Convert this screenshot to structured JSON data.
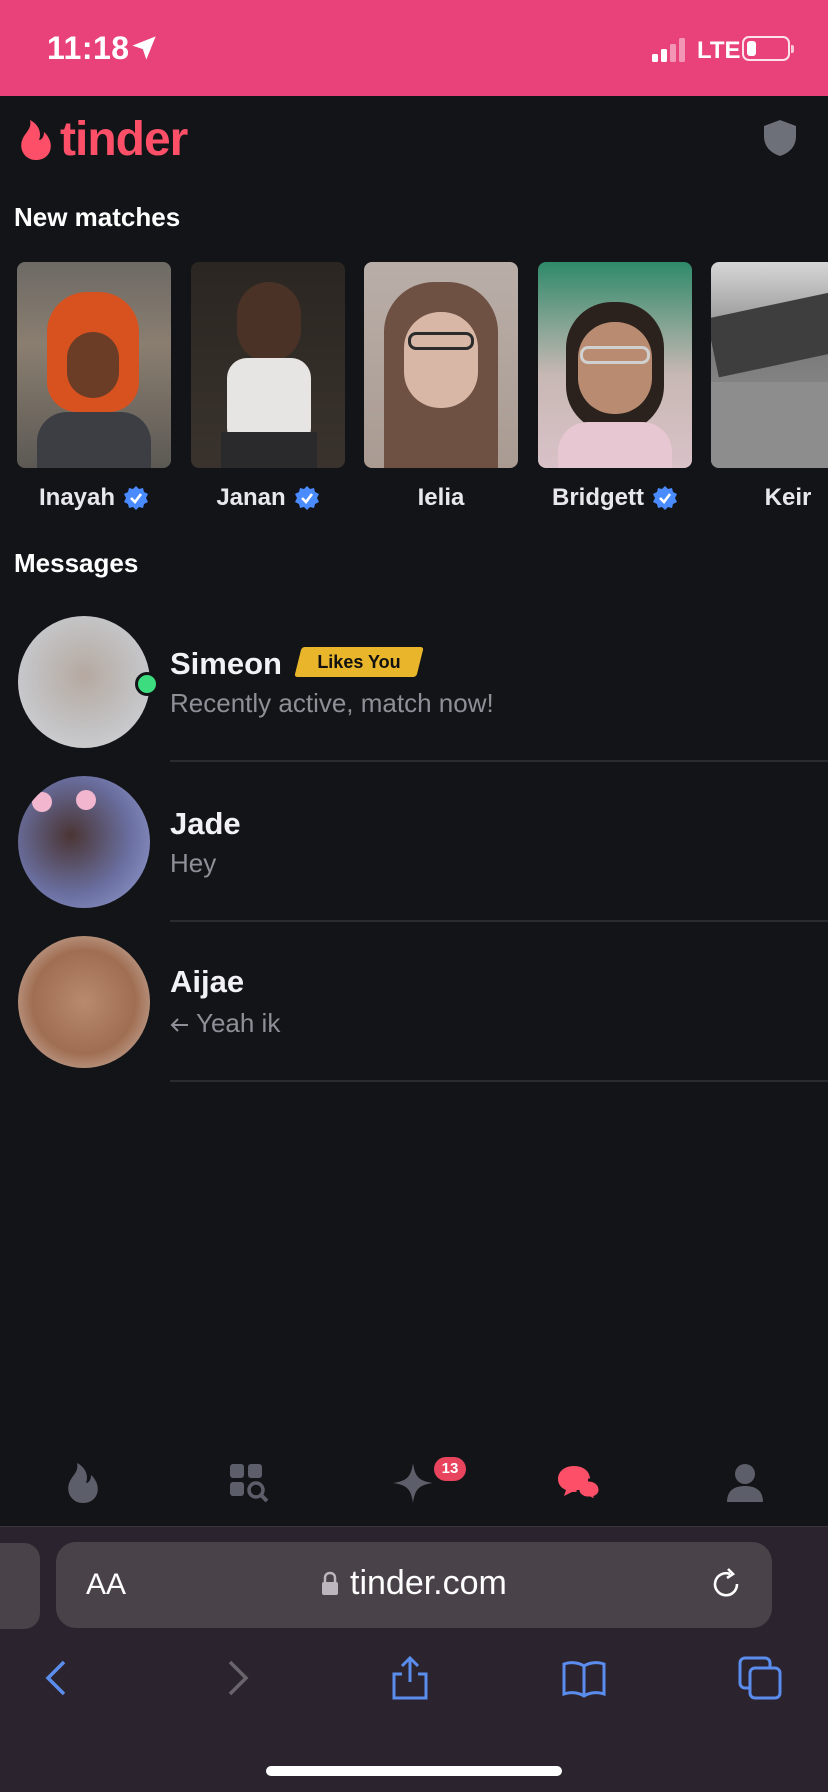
{
  "status": {
    "time": "11:18",
    "network": "LTE"
  },
  "brand": {
    "name": "tinder",
    "color": "#fd5068"
  },
  "new_matches": {
    "title": "New matches",
    "items": [
      {
        "name": "Inayah",
        "verified": true
      },
      {
        "name": "Janan",
        "verified": true
      },
      {
        "name": "Ielia",
        "verified": false
      },
      {
        "name": "Bridgett",
        "verified": true
      },
      {
        "name": "Keir",
        "verified": false
      }
    ]
  },
  "messages": {
    "title": "Messages",
    "items": [
      {
        "name": "Simeon",
        "badge": "Likes You",
        "preview": "Recently active, match now!",
        "online": true
      },
      {
        "name": "Jade",
        "preview": "Hey"
      },
      {
        "name": "Aijae",
        "preview": "Yeah ik",
        "replied": true
      }
    ]
  },
  "tabbar": {
    "items": [
      "flame-icon",
      "explore-icon",
      "gold-spark-icon",
      "chat-icon",
      "profile-icon"
    ],
    "active": "chat-icon",
    "spark_badge": "13"
  },
  "browser": {
    "aa_label": "AA",
    "url": "tinder.com"
  },
  "colors": {
    "accent": "#fd5068",
    "status_bar": "#e9417a",
    "verified": "#4a8cff",
    "likes_badge": "#e9b52a",
    "online": "#3ddc7e"
  }
}
